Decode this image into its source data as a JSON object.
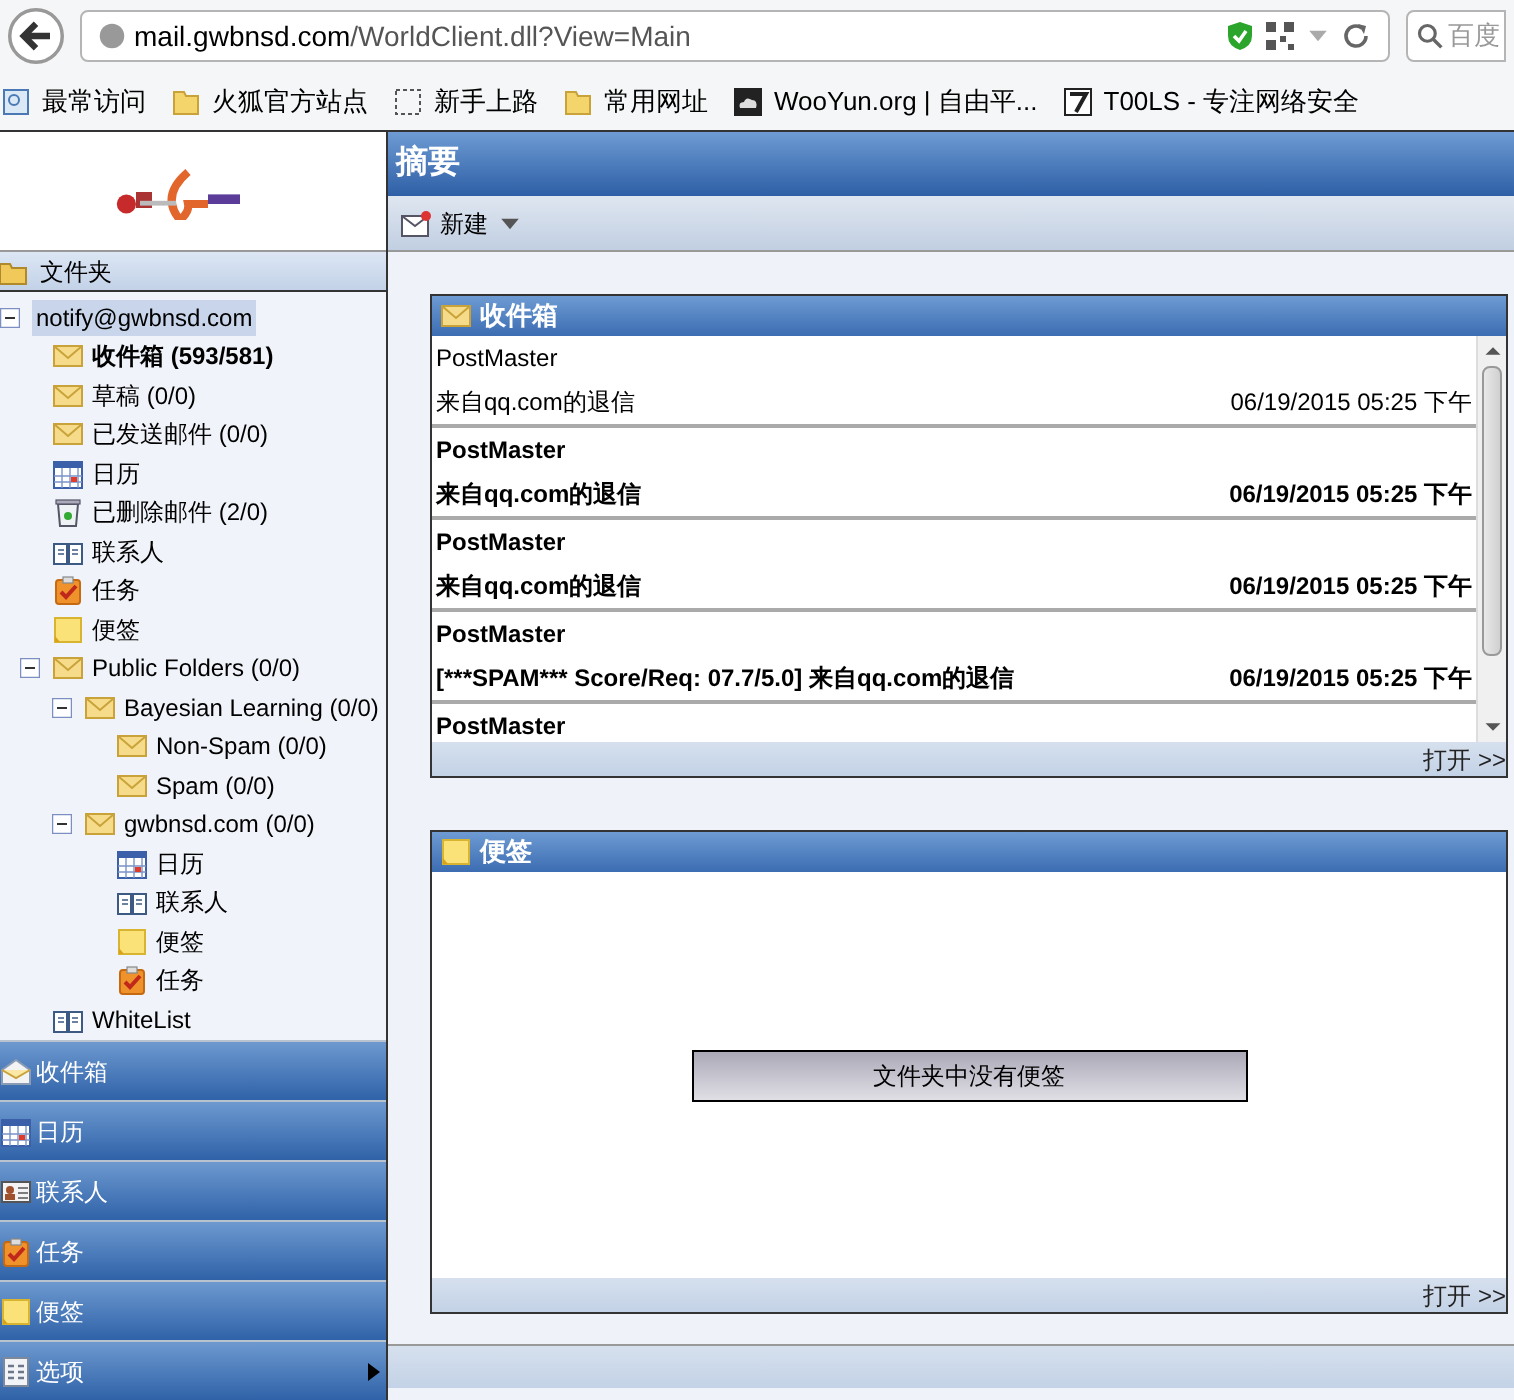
{
  "browser": {
    "url_host": "mail.gwbnsd.com",
    "url_path": "/WorldClient.dll?View=Main",
    "search_placeholder": "百度",
    "bookmarks": [
      {
        "label": "最常访问",
        "kind": "recent"
      },
      {
        "label": "火狐官方站点",
        "kind": "folder"
      },
      {
        "label": "新手上路",
        "kind": "dashed"
      },
      {
        "label": "常用网址",
        "kind": "folder"
      },
      {
        "label": "WooYun.org | 自由平...",
        "kind": "cloud"
      },
      {
        "label": "T00LS - 专注网络安全",
        "kind": "seven"
      }
    ]
  },
  "sidebar": {
    "header": "文件夹",
    "tree": [
      {
        "label": "notify@gwbnsd.com",
        "selected": true,
        "bold": false,
        "expanded": true,
        "children": [
          {
            "label": "收件箱 (593/581)",
            "kind": "mail",
            "selected": false,
            "bold": true
          },
          {
            "label": "草稿 (0/0)",
            "kind": "mail",
            "selected": false,
            "bold": false
          },
          {
            "label": "已发送邮件 (0/0)",
            "kind": "mail",
            "selected": false,
            "bold": false
          },
          {
            "label": "日历",
            "kind": "calendar",
            "selected": false,
            "bold": false
          },
          {
            "label": "已删除邮件 (2/0)",
            "kind": "trash",
            "selected": false,
            "bold": false
          },
          {
            "label": "联系人",
            "kind": "book",
            "selected": false,
            "bold": false
          },
          {
            "label": "任务",
            "kind": "task",
            "selected": false,
            "bold": false
          },
          {
            "label": "便签",
            "kind": "note",
            "selected": false,
            "bold": false
          },
          {
            "label": "Public Folders (0/0)",
            "kind": "mail",
            "selected": false,
            "bold": false,
            "expanded": true,
            "children": [
              {
                "label": "Bayesian Learning (0/0)",
                "kind": "mail",
                "selected": false,
                "bold": false,
                "expanded": true,
                "children": [
                  {
                    "label": "Non-Spam (0/0)",
                    "kind": "mail",
                    "selected": false,
                    "bold": false
                  },
                  {
                    "label": "Spam (0/0)",
                    "kind": "mail",
                    "selected": false,
                    "bold": false
                  }
                ]
              },
              {
                "label": "gwbnsd.com (0/0)",
                "kind": "mail",
                "selected": false,
                "bold": false,
                "expanded": true,
                "children": [
                  {
                    "label": "日历",
                    "kind": "calendar",
                    "selected": false,
                    "bold": false
                  },
                  {
                    "label": "联系人",
                    "kind": "book",
                    "selected": false,
                    "bold": false
                  },
                  {
                    "label": "便签",
                    "kind": "note",
                    "selected": false,
                    "bold": false
                  },
                  {
                    "label": "任务",
                    "kind": "task",
                    "selected": false,
                    "bold": false
                  }
                ]
              }
            ]
          },
          {
            "label": "WhiteList",
            "kind": "book",
            "selected": false,
            "bold": false
          }
        ]
      }
    ],
    "nav": [
      {
        "label": "收件箱",
        "kind": "inbox",
        "submenu": false
      },
      {
        "label": "日历",
        "kind": "calendar",
        "submenu": false
      },
      {
        "label": "联系人",
        "kind": "card",
        "submenu": false
      },
      {
        "label": "任务",
        "kind": "task",
        "submenu": false
      },
      {
        "label": "便签",
        "kind": "note",
        "submenu": false
      },
      {
        "label": "选项",
        "kind": "options",
        "submenu": true
      }
    ]
  },
  "main": {
    "title": "摘要",
    "toolbar": {
      "new_button": "新建"
    },
    "inbox": {
      "title": "收件箱",
      "messages": [
        {
          "sender": "PostMaster",
          "subject": "来自qq.com的退信",
          "date": "06/19/2015 05:25 下午",
          "unread": false
        },
        {
          "sender": "PostMaster",
          "subject": "来自qq.com的退信",
          "date": "06/19/2015 05:25 下午",
          "unread": true
        },
        {
          "sender": "PostMaster",
          "subject": "来自qq.com的退信",
          "date": "06/19/2015 05:25 下午",
          "unread": true
        },
        {
          "sender": "PostMaster",
          "subject": "[***SPAM*** Score/Req: 07.7/5.0] 来自qq.com的退信",
          "date": "06/19/2015 05:25 下午",
          "unread": true
        },
        {
          "sender": "PostMaster",
          "unread": true
        }
      ],
      "open_link": "打开 >>"
    },
    "notes": {
      "title": "便签",
      "empty_message": "文件夹中没有便签",
      "open_link": "打开 >>"
    }
  }
}
